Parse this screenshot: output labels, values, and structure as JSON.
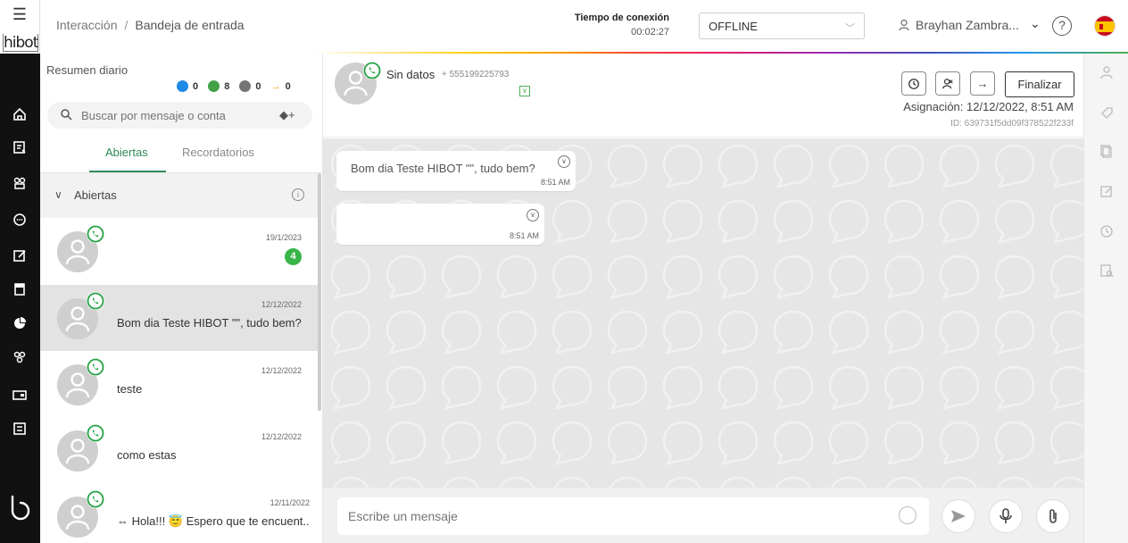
{
  "app": {
    "logo_text": "hibot"
  },
  "header": {
    "breadcrumb": {
      "root": "Interacción",
      "separator": "/",
      "current": "Bandeja de entrada"
    },
    "connection": {
      "label": "Tiempo de conexión",
      "time": "00:02:27"
    },
    "status": {
      "value": "OFFLINE"
    },
    "user": {
      "name": "Brayhan Zambra..."
    },
    "help": "?"
  },
  "rail": {
    "icons": [
      "home-icon",
      "inbox-icon",
      "network-icon",
      "chat-icon",
      "edit-icon",
      "book-icon",
      "pie-chart-icon",
      "bot-icon",
      "wallet-icon",
      "report-icon"
    ]
  },
  "summary": {
    "title": "Resumen diario",
    "counters": [
      {
        "name": "info",
        "value": "0",
        "color": "#1e88e5"
      },
      {
        "name": "chats",
        "value": "8",
        "color": "#43a047"
      },
      {
        "name": "clock",
        "value": "0",
        "color": "#757575"
      },
      {
        "name": "transfer",
        "value": "0",
        "color": "#ff9800"
      }
    ]
  },
  "search": {
    "placeholder": "Buscar por mensaje o conta",
    "add_label": "+"
  },
  "tabs": {
    "open": "Abiertas",
    "reminders": "Recordatorios"
  },
  "section": {
    "label": "Abiertas",
    "info": "i"
  },
  "conversations": [
    {
      "date": "19/1/2023",
      "message": "",
      "badge": "4"
    },
    {
      "date": "12/12/2022",
      "message": "Bom dia Teste HIBOT \"\", tudo bem?"
    },
    {
      "date": "12/12/2022",
      "message": "teste"
    },
    {
      "date": "12/12/2022",
      "message": "como estas"
    },
    {
      "date": "12/11/2022",
      "message": "⇔ Hola!!! 😇 Espero que te encuent..."
    }
  ],
  "chat": {
    "name": "Sin datos",
    "phone": "+ 555199225793",
    "finalize_label": "Finalizar",
    "assignment": "Asignación: 12/12/2022, 8:51 AM",
    "id": "ID: 639731f5dd09f378522f233f",
    "messages": [
      {
        "text": "Bom dia Teste HIBOT \"\", tudo bem?",
        "time": "8:51 AM"
      },
      {
        "text": "",
        "time": "8:51 AM"
      }
    ]
  },
  "composer": {
    "placeholder": "Escribe un mensaje"
  },
  "colors": {
    "accent": "#2e8b57",
    "whatsapp": "#25d366",
    "badge": "#3ab54a"
  }
}
